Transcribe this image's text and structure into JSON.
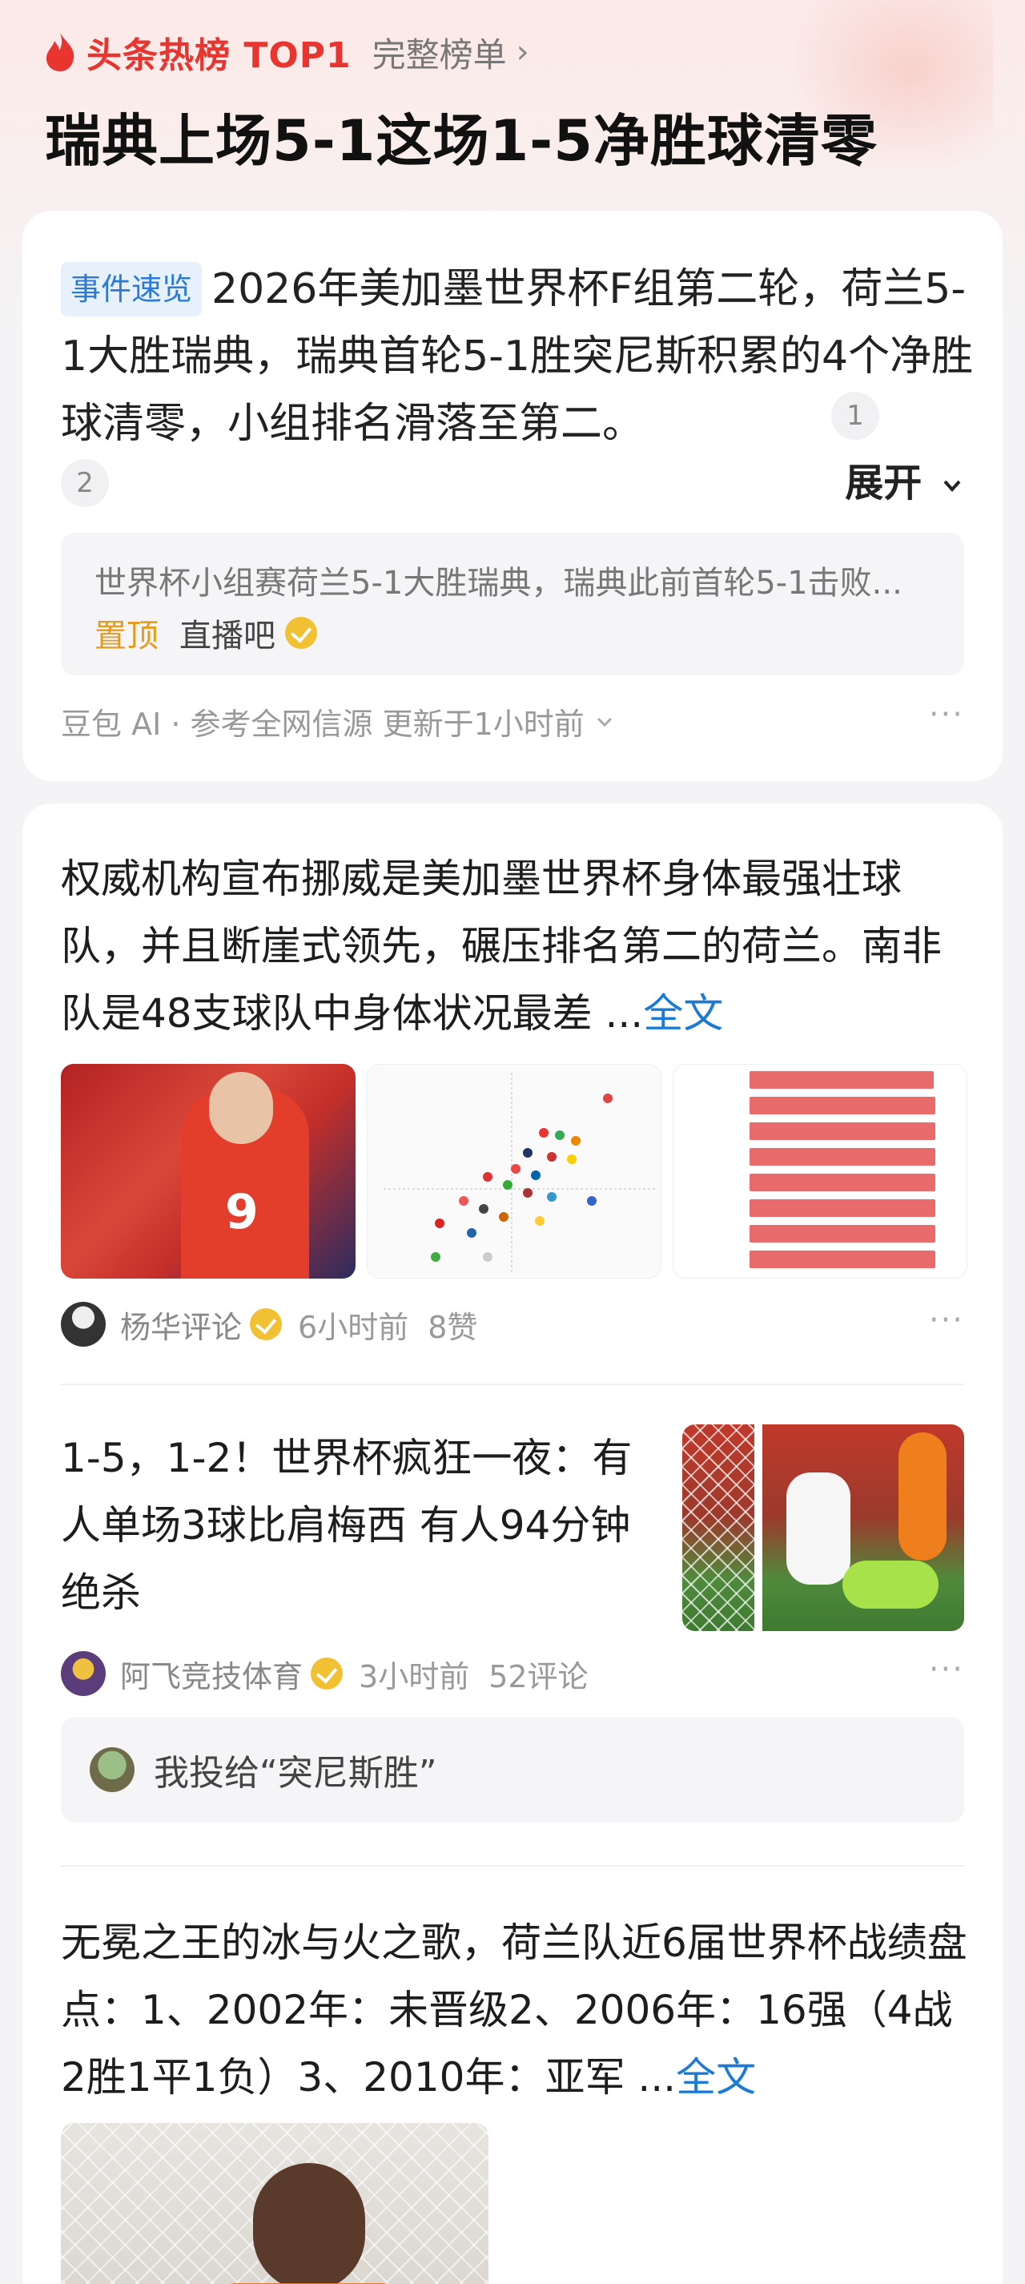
{
  "header": {
    "rank_label": "头条热榜 TOP1",
    "full_list": "完整榜单",
    "chevron": "›",
    "topic_title": "瑞典上场5-1这场1-5净胜球清零",
    "accent_color": "#e8352f"
  },
  "summary": {
    "tag": "事件速览",
    "text": "2026年美加墨世界杯F组第二轮，荷兰5-1大胜瑞典，瑞典首轮5-1胜突尼斯积累的4个净胜球清零，小组排名滑落至第二。",
    "ref1": "1",
    "ref2": "2",
    "expand_label": "展开",
    "source_text": "世界杯小组赛荷兰5-1大胜瑞典，瑞典此前首轮5-1击败...",
    "source_pin": "置顶",
    "source_name": "直播吧",
    "footer": "豆包 AI · 参考全网信源 更新于1小时前",
    "more": "···"
  },
  "articles": [
    {
      "text": "权威机构宣布挪威是美加墨世界杯身体最强壮球队，并且断崖式领先，碾压排名第二的荷兰。南非队是48支球队中身体状况最差 ...",
      "fulltext_label": "全文",
      "author": "杨华评论",
      "time": "6小时前",
      "stat": "8赞",
      "more": "···"
    },
    {
      "text": "1-5，1-2！世界杯疯狂一夜：有人单场3球比肩梅西 有人94分钟绝杀",
      "author": "阿飞竞技体育",
      "time": "3小时前",
      "stat": "52评论",
      "more": "···",
      "vote": "我投给“突尼斯胜”"
    },
    {
      "text": "无冕之王的冰与火之歌，荷兰队近6届世界杯战绩盘点：1、2002年：未晋级2、2006年：16强（4战2胜1平1负）3、2010年：亚军 ...",
      "fulltext_label": "全文"
    }
  ],
  "icons": {
    "flame": "flame-icon",
    "chevron_down": "chevron-down-icon",
    "verified": "verified-badge-icon",
    "more": "more-dots-icon"
  }
}
